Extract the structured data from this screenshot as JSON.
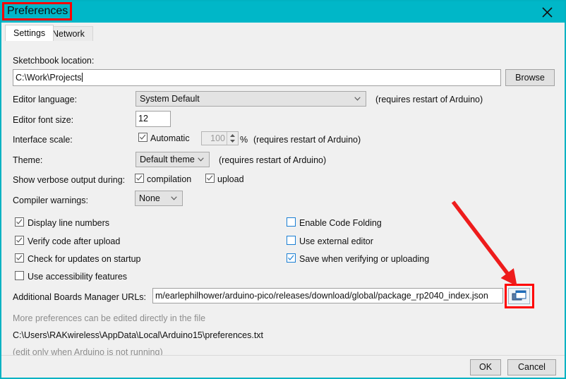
{
  "window": {
    "title": "Preferences",
    "close_icon": "close-x-icon",
    "accent_color": "#00b7c8",
    "highlight_color": "#ff0000"
  },
  "tabs": [
    {
      "label": "Settings",
      "active": true
    },
    {
      "label": "Network",
      "active": false
    }
  ],
  "form": {
    "sketchbook": {
      "label": "Sketchbook location:",
      "value": "C:\\Work\\Projects",
      "browse_label": "Browse"
    },
    "editor_language": {
      "label": "Editor language:",
      "value": "System Default",
      "note": "(requires restart of Arduino)"
    },
    "editor_font_size": {
      "label": "Editor font size:",
      "value": "12"
    },
    "interface_scale": {
      "label": "Interface scale:",
      "automatic_label": "Automatic",
      "automatic_checked": true,
      "scale_value": "100",
      "percent_label": "%",
      "note": "(requires restart of Arduino)"
    },
    "theme": {
      "label": "Theme:",
      "value": "Default theme",
      "note": "(requires restart of Arduino)"
    },
    "verbose_output": {
      "label": "Show verbose output during:",
      "compilation_label": "compilation",
      "compilation_checked": true,
      "upload_label": "upload",
      "upload_checked": true
    },
    "compiler_warnings": {
      "label": "Compiler warnings:",
      "value": "None"
    }
  },
  "options_left": [
    {
      "label": "Display line numbers",
      "checked": true
    },
    {
      "label": "Verify code after upload",
      "checked": true
    },
    {
      "label": "Check for updates on startup",
      "checked": true
    },
    {
      "label": "Use accessibility features",
      "checked": false
    }
  ],
  "options_right": [
    {
      "label": "Enable Code Folding",
      "checked": false
    },
    {
      "label": "Use external editor",
      "checked": false
    },
    {
      "label": "Save when verifying or uploading",
      "checked": true
    }
  ],
  "boards_urls": {
    "label": "Additional Boards Manager URLs:",
    "value": "m/earlephilhower/arduino-pico/releases/download/global/package_rp2040_index.json",
    "edit_button_icon": "windows-cascade-icon"
  },
  "footer_notes": {
    "line1": "More preferences can be edited directly in the file",
    "path": "C:\\Users\\RAKwireless\\AppData\\Local\\Arduino15\\preferences.txt",
    "line3": "(edit only when Arduino is not running)"
  },
  "buttons": {
    "ok": "OK",
    "cancel": "Cancel"
  }
}
